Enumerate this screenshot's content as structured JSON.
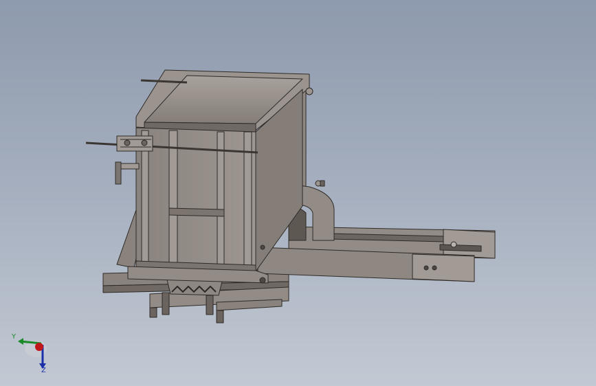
{
  "scene": {
    "background_top": "#8e9aad",
    "background_bottom": "#c2c9d3",
    "model_color": "#918a84",
    "model_dark": "#5c5650",
    "model_light": "#b3ada7"
  },
  "triad": {
    "y_label": "Y",
    "z_label": "Z",
    "y_color": "#1d8a2a",
    "z_color": "#1a2fa8",
    "x_color": "#c01818"
  }
}
